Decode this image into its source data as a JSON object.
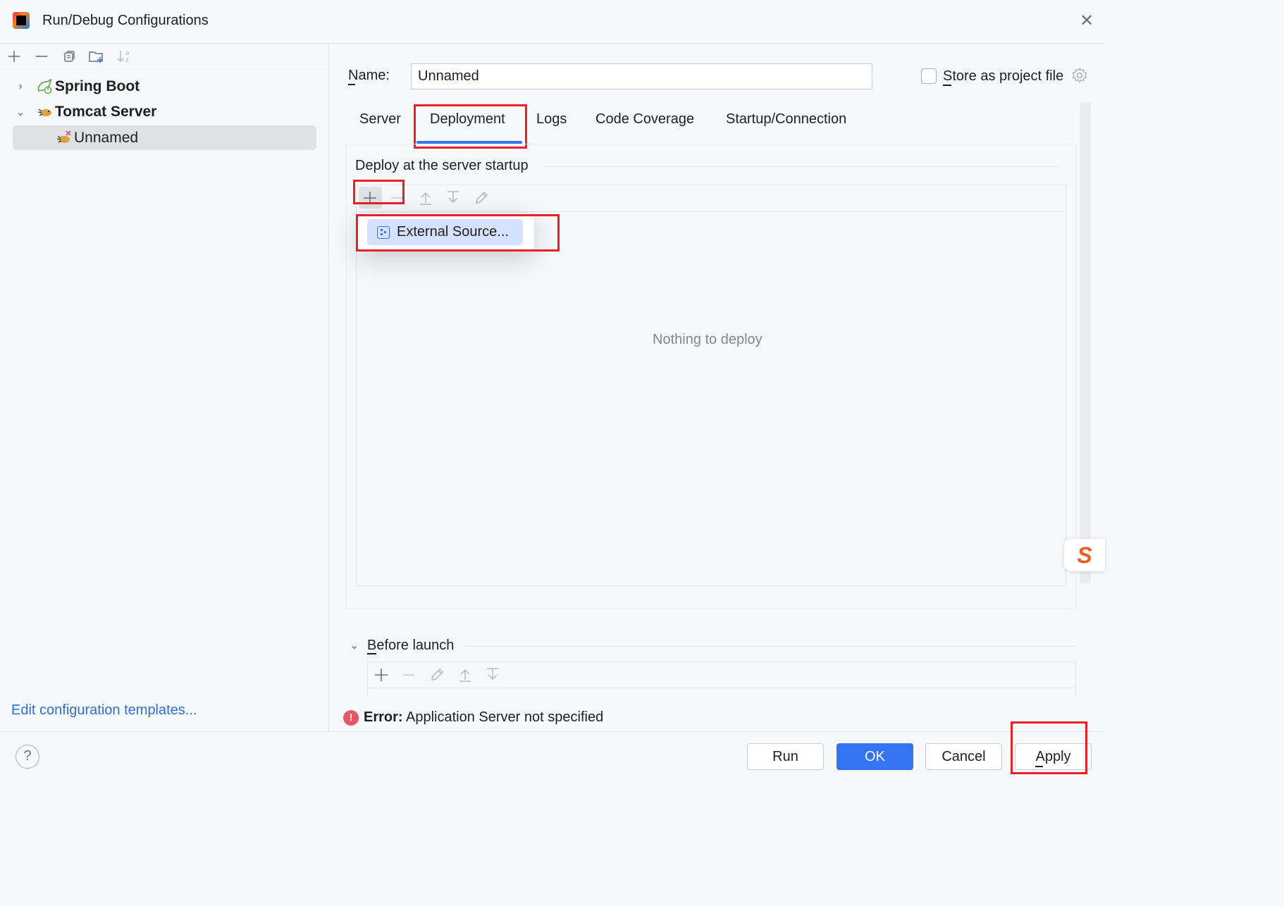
{
  "window": {
    "title": "Run/Debug Configurations",
    "close_glyph": "✕"
  },
  "left_toolbar": {
    "icons": [
      "add-icon",
      "remove-icon",
      "copy-icon",
      "new-folder-icon",
      "sort-icon"
    ]
  },
  "tree": {
    "spring_boot": "Spring Boot",
    "tomcat_server": "Tomcat Server",
    "unnamed": "Unnamed"
  },
  "edit_templates_link": "Edit configuration templates...",
  "name": {
    "label": "Name:",
    "value": "Unnamed"
  },
  "store_as_project_file": {
    "label": "Store as project file",
    "checked": false
  },
  "tabs": {
    "server": "Server",
    "deployment": "Deployment",
    "logs": "Logs",
    "code_coverage": "Code Coverage",
    "startup_connection": "Startup/Connection",
    "active": "Deployment"
  },
  "deployment": {
    "section_title": "Deploy at the server startup",
    "empty_text": "Nothing to deploy",
    "popup_item": "External Source..."
  },
  "before_launch": {
    "label": "Before launch"
  },
  "error": {
    "prefix": "Error:",
    "message": "Application Server not specified"
  },
  "footer": {
    "help": "?",
    "run": "Run",
    "ok": "OK",
    "cancel": "Cancel",
    "apply": "Apply"
  },
  "colors": {
    "accent": "#3574f0",
    "highlight_box": "#e8202a",
    "error": "#e55765",
    "link": "#2f6fce"
  }
}
